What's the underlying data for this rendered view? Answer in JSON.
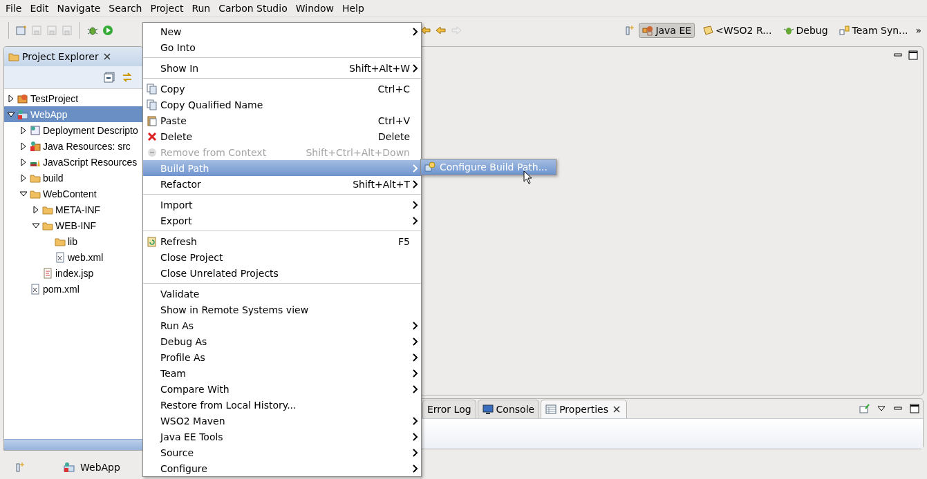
{
  "menu_bar": [
    {
      "label": "File"
    },
    {
      "label": "Edit"
    },
    {
      "label": "Navigate"
    },
    {
      "label": "Search"
    },
    {
      "label": "Project"
    },
    {
      "label": "Run"
    },
    {
      "label": "Carbon Studio"
    },
    {
      "label": "Window"
    },
    {
      "label": "Help"
    }
  ],
  "perspectives": [
    {
      "label": "Java EE",
      "selected": true
    },
    {
      "label": "<WSO2 R...",
      "selected": false
    },
    {
      "label": "Debug",
      "selected": false
    },
    {
      "label": "Team Syn...",
      "selected": false
    }
  ],
  "perspectives_more": "»",
  "project_explorer": {
    "title": "Project Explorer",
    "tree": [
      {
        "label": "TestProject",
        "kind": "project",
        "expanded": false,
        "selected": false
      },
      {
        "label": "WebApp",
        "kind": "webproject",
        "expanded": true,
        "selected": true,
        "children": [
          {
            "label": "Deployment Descripto",
            "kind": "descriptor",
            "expanded": false,
            "selected": false
          },
          {
            "label": "Java Resources: src",
            "kind": "javares",
            "expanded": false,
            "selected": false
          },
          {
            "label": "JavaScript Resources",
            "kind": "jsres",
            "expanded": false,
            "selected": false
          },
          {
            "label": "build",
            "kind": "folder",
            "expanded": false,
            "selected": false
          },
          {
            "label": "WebContent",
            "kind": "folder",
            "expanded": true,
            "selected": false,
            "children": [
              {
                "label": "META-INF",
                "kind": "folder",
                "expanded": false,
                "selected": false
              },
              {
                "label": "WEB-INF",
                "kind": "folder",
                "expanded": true,
                "selected": false,
                "children": [
                  {
                    "label": "lib",
                    "kind": "folder",
                    "selected": false
                  },
                  {
                    "label": "web.xml",
                    "kind": "xml",
                    "selected": false
                  }
                ]
              },
              {
                "label": "index.jsp",
                "kind": "jsp",
                "selected": false
              }
            ]
          },
          {
            "label": "pom.xml",
            "kind": "xml",
            "selected": false
          }
        ]
      }
    ]
  },
  "context_menu": [
    {
      "kind": "item",
      "label": "New",
      "submenu": true,
      "selected": false
    },
    {
      "kind": "item",
      "label": "Go Into",
      "selected": false
    },
    {
      "kind": "separator"
    },
    {
      "kind": "item",
      "label": "Show In",
      "shortcut": "Shift+Alt+W",
      "submenu": true,
      "selected": false
    },
    {
      "kind": "separator"
    },
    {
      "kind": "copy",
      "label": "Copy",
      "shortcut": "Ctrl+C",
      "selected": false
    },
    {
      "kind": "copy",
      "label": "Copy Qualified Name",
      "selected": false
    },
    {
      "kind": "paste",
      "label": "Paste",
      "shortcut": "Ctrl+V",
      "selected": false
    },
    {
      "kind": "delete",
      "label": "Delete",
      "shortcut": "Delete",
      "selected": false
    },
    {
      "kind": "remove",
      "label": "Remove from Context",
      "shortcut": "Shift+Ctrl+Alt+Down",
      "disabled": true,
      "selected": false
    },
    {
      "kind": "item",
      "label": "Build Path",
      "submenu": true,
      "selected": true
    },
    {
      "kind": "item",
      "label": "Refactor",
      "shortcut": "Shift+Alt+T",
      "submenu": true,
      "selected": false
    },
    {
      "kind": "separator"
    },
    {
      "kind": "item",
      "label": "Import",
      "submenu": true,
      "selected": false
    },
    {
      "kind": "item",
      "label": "Export",
      "submenu": true,
      "selected": false
    },
    {
      "kind": "separator"
    },
    {
      "kind": "refresh",
      "label": "Refresh",
      "shortcut": "F5",
      "selected": false
    },
    {
      "kind": "item",
      "label": "Close Project",
      "selected": false
    },
    {
      "kind": "item",
      "label": "Close Unrelated Projects",
      "selected": false
    },
    {
      "kind": "separator"
    },
    {
      "kind": "item",
      "label": "Validate",
      "selected": false
    },
    {
      "kind": "item",
      "label": "Show in Remote Systems view",
      "selected": false
    },
    {
      "kind": "item",
      "label": "Run As",
      "submenu": true,
      "selected": false
    },
    {
      "kind": "item",
      "label": "Debug As",
      "submenu": true,
      "selected": false
    },
    {
      "kind": "item",
      "label": "Profile As",
      "submenu": true,
      "selected": false
    },
    {
      "kind": "item",
      "label": "Team",
      "submenu": true,
      "selected": false
    },
    {
      "kind": "item",
      "label": "Compare With",
      "submenu": true,
      "selected": false
    },
    {
      "kind": "item",
      "label": "Restore from Local History...",
      "selected": false
    },
    {
      "kind": "item",
      "label": "WSO2 Maven",
      "submenu": true,
      "selected": false
    },
    {
      "kind": "item",
      "label": "Java EE Tools",
      "submenu": true,
      "selected": false
    },
    {
      "kind": "item",
      "label": "Source",
      "submenu": true,
      "selected": false
    },
    {
      "kind": "item",
      "label": "Configure",
      "submenu": true,
      "selected": false
    }
  ],
  "submenu": [
    {
      "label": "Configure Build Path...",
      "selected": true
    }
  ],
  "bottom_tabs": [
    {
      "label": "Error Log",
      "kind": "plain",
      "selected": false
    },
    {
      "label": "Console",
      "kind": "console",
      "selected": false
    },
    {
      "label": "Properties",
      "kind": "properties",
      "selected": true
    }
  ],
  "status_bar": {
    "label": "WebApp"
  }
}
